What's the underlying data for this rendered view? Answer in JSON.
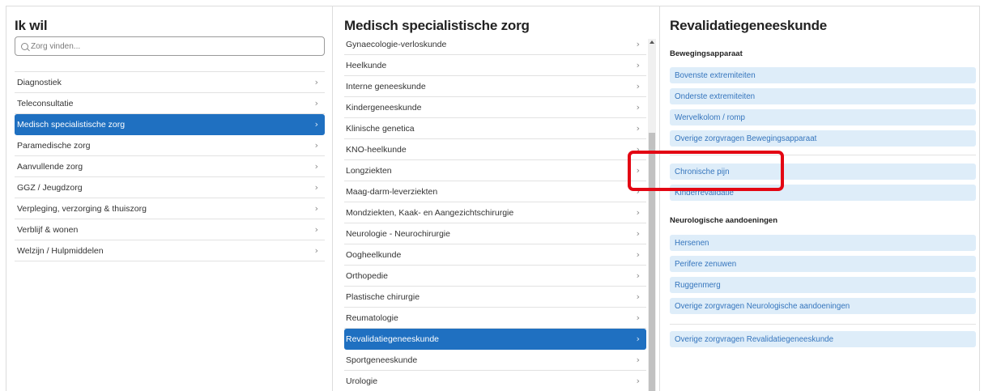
{
  "left_panel": {
    "title": "Ik wil",
    "search_placeholder": "Zorg vinden...",
    "items": [
      {
        "label": "Diagnostiek"
      },
      {
        "label": "Teleconsultatie"
      },
      {
        "label": "Medisch specialistische zorg",
        "selected": true
      },
      {
        "label": "Paramedische zorg"
      },
      {
        "label": "Aanvullende zorg"
      },
      {
        "label": "GGZ / Jeugdzorg"
      },
      {
        "label": "Verpleging, verzorging & thuiszorg"
      },
      {
        "label": "Verblijf & wonen"
      },
      {
        "label": "Welzijn / Hulpmiddelen"
      }
    ]
  },
  "middle_panel": {
    "title": "Medisch specialistische zorg",
    "items": [
      {
        "label": "Gynaecologie-verloskunde"
      },
      {
        "label": "Heelkunde"
      },
      {
        "label": "Interne geneeskunde"
      },
      {
        "label": "Kindergeneeskunde"
      },
      {
        "label": "Klinische genetica"
      },
      {
        "label": "KNO-heelkunde"
      },
      {
        "label": "Longziekten"
      },
      {
        "label": "Maag-darm-leverziekten"
      },
      {
        "label": "Mondziekten, Kaak- en Aangezichtschirurgie"
      },
      {
        "label": "Neurologie - Neurochirurgie"
      },
      {
        "label": "Oogheelkunde"
      },
      {
        "label": "Orthopedie"
      },
      {
        "label": "Plastische chirurgie"
      },
      {
        "label": "Reumatologie"
      },
      {
        "label": "Revalidatiegeneeskunde",
        "selected": true
      },
      {
        "label": "Sportgeneeskunde"
      },
      {
        "label": "Urologie"
      }
    ]
  },
  "right_panel": {
    "title": "Revalidatiegeneeskunde",
    "sections": [
      {
        "title": "Bewegingsapparaat",
        "items": [
          "Bovenste extremiteiten",
          "Onderste extremiteiten",
          "Wervelkolom / romp",
          "Overige zorgvragen Bewegingsapparaat"
        ]
      },
      {
        "title": "",
        "items": [
          "Chronische pijn",
          "Kinderrevalidatie"
        ]
      },
      {
        "title": "Neurologische aandoeningen",
        "items": [
          "Hersenen",
          "Perifere zenuwen",
          "Ruggenmerg",
          "Overige zorgvragen Neurologische aandoeningen"
        ]
      },
      {
        "title": "",
        "items": [
          "Overige zorgvragen Revalidatiegeneeskunde"
        ]
      }
    ]
  },
  "icons": {
    "chevron": "›",
    "search": "search-icon"
  },
  "colors": {
    "selected_bg": "#1f70c1",
    "pill_bg": "#deedf9",
    "pill_text": "#3575bd",
    "highlight": "#e30613"
  }
}
